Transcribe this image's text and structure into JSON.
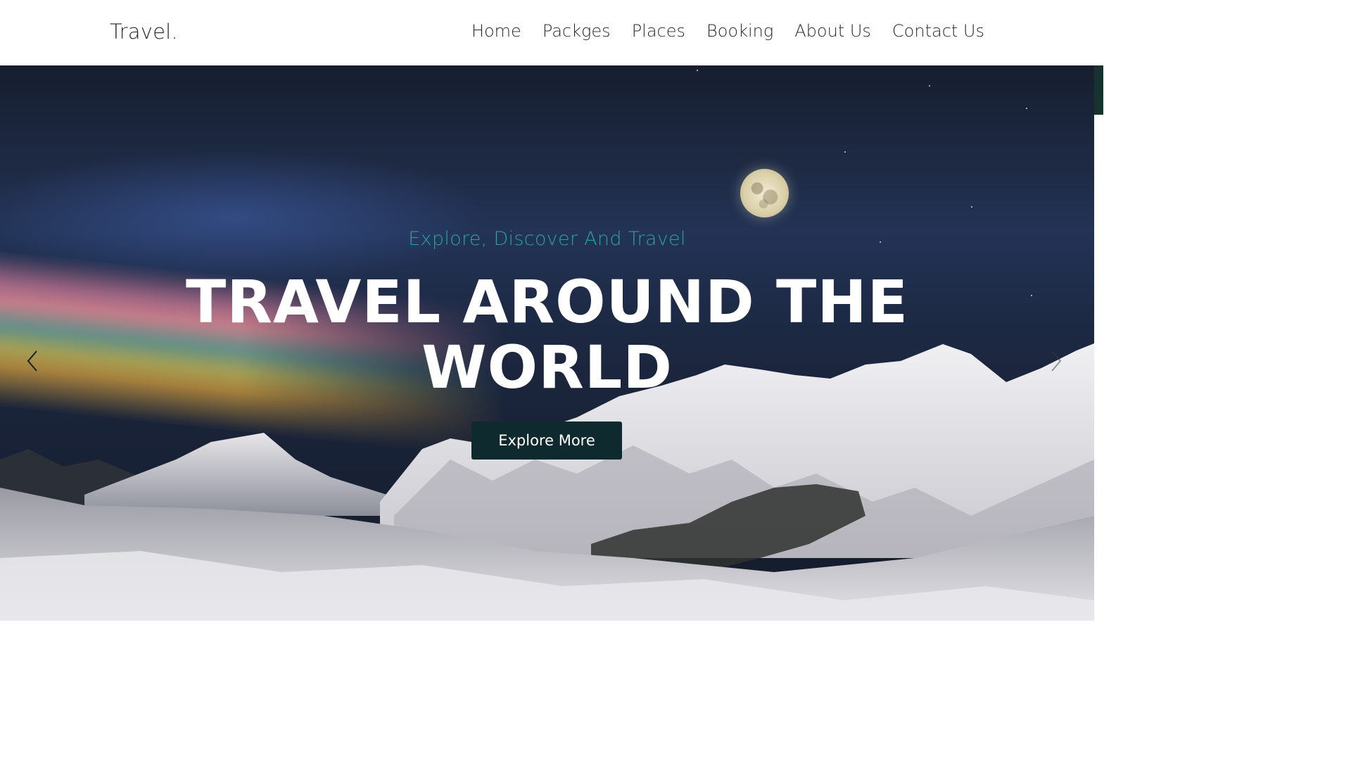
{
  "header": {
    "logo": "Travel.",
    "nav": [
      {
        "label": "Home"
      },
      {
        "label": "Packges"
      },
      {
        "label": "Places"
      },
      {
        "label": "Booking"
      },
      {
        "label": "About Us"
      },
      {
        "label": "Contact Us"
      }
    ]
  },
  "hero": {
    "subtitle": "Explore, Discover And Travel",
    "title_line1": "TRAVEL AROUND THE",
    "title_line2": "WORLD",
    "button_label": "Explore More",
    "prev_icon": "chevron-left-icon",
    "next_icon": "chevron-right-icon"
  },
  "colors": {
    "accent": "#2aa29a",
    "button_bg": "#0f2a2e",
    "nav_text": "#1f2a33",
    "title_text": "#ffffff"
  }
}
